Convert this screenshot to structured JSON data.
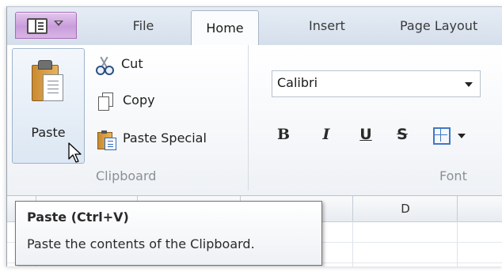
{
  "tabs": [
    {
      "label": "File"
    },
    {
      "label": "Home"
    },
    {
      "label": "Insert"
    },
    {
      "label": "Page Layout"
    }
  ],
  "active_tab": "Home",
  "clipboard_group": {
    "label": "Clipboard",
    "paste_label": "Paste",
    "cut_label": "Cut",
    "copy_label": "Copy",
    "paste_special_label": "Paste Special"
  },
  "font_group": {
    "label": "Font",
    "font_name": "Calibri",
    "bold": "B",
    "italic": "I",
    "underline": "U",
    "strikethrough": "S"
  },
  "grid": {
    "column_headers": [
      "D"
    ]
  },
  "tooltip": {
    "title": "Paste (Ctrl+V)",
    "description": "Paste the contents of the Clipboard."
  },
  "icons": {
    "app_menu": "window-layout-icon",
    "paste": "clipboard-icon",
    "cut": "scissors-icon",
    "copy": "copy-icon",
    "paste_special": "paste-special-icon",
    "borders": "borders-icon",
    "cursor": "mouse-pointer-icon"
  },
  "colors": {
    "app_menu_purple": "#c99cda",
    "ribbon_border": "#a9b7c8",
    "group_label": "#8a9096"
  }
}
